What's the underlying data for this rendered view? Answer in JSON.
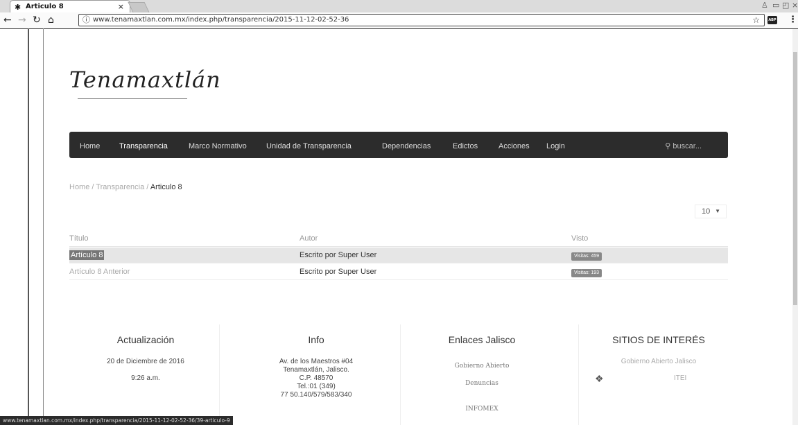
{
  "browser": {
    "tab_title": "Articulo 8",
    "tab_close": "×",
    "url": "www.tenamaxtlan.com.mx/index.php/transparencia/2015-11-12-02-52-36",
    "status_url": "www.tenamaxtlan.com.mx/index.php/transparencia/2015-11-12-02-52-36/39-articulo-9",
    "abp_label": "ABP"
  },
  "site": {
    "logo": "Tenamaxtlán"
  },
  "nav": {
    "items": [
      "Home",
      "Transparencia",
      "Marco Normativo",
      "Unidad de Transparencia",
      "Dependencias",
      "Edictos",
      "Acciones",
      "Login"
    ],
    "active": "Transparencia",
    "search_placeholder": "buscar..."
  },
  "breadcrumb": {
    "home": "Home",
    "section": "Transparencia",
    "current": "Articulo 8",
    "separator": "/"
  },
  "list_limit": "10",
  "table": {
    "headers": [
      "Título",
      "Autor",
      "Visto"
    ],
    "rows": [
      {
        "title": "Artículo 8",
        "author": "Escrito por Super User",
        "hits": "Visitas: 459"
      },
      {
        "title": "Artículo 8 Anterior",
        "author": "Escrito por Super User",
        "hits": "Visitas: 193"
      }
    ]
  },
  "footer": {
    "update": {
      "heading": "Actualización",
      "date": "20 de Diciembre de 2016",
      "time": "9:26 a.m."
    },
    "info": {
      "heading": "Info",
      "lines": [
        "Av. de los Maestros #04",
        "Tenamaxtlán, Jalisco.",
        "C.P. 48570",
        "Tel.:01 (349)",
        "77 50.140/579/583/340"
      ]
    },
    "links": {
      "heading": "Enlaces Jalisco",
      "items": [
        "Gobierno Abierto",
        "Denuncias",
        "INFOMEX"
      ]
    },
    "sites": {
      "heading": "SITIOS DE INTERÉS",
      "items": [
        "Gobierno Abierto Jalisco",
        "ITEI"
      ]
    }
  }
}
